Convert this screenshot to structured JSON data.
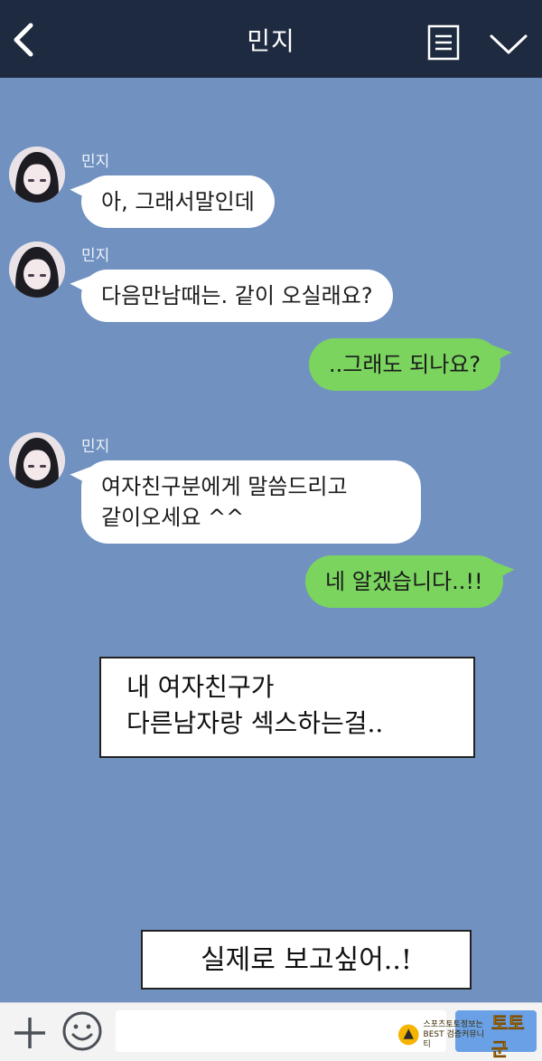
{
  "header": {
    "title": "민지",
    "back_icon": "chevron-left-icon",
    "menu_icon": "document-list-icon",
    "collapse_icon": "chevron-down-icon",
    "background": "#1e2a3f"
  },
  "chat": {
    "background": "#7192c1",
    "messages": [
      {
        "type": "received",
        "sender": "민지",
        "text": "아, 그래서말인데"
      },
      {
        "type": "received",
        "sender": "민지",
        "text": "다음만남때는. 같이 오실래요?"
      },
      {
        "type": "sent",
        "text": "..그래도 되나요?"
      },
      {
        "type": "received",
        "sender": "민지",
        "text": "여자친구분에게 말씀드리고\n같이오세요 ^^"
      },
      {
        "type": "sent",
        "text": "네 알겠습니다..!!"
      }
    ]
  },
  "captions": [
    {
      "text": "내 여자친구가\n다른남자랑 섹스하는걸.."
    },
    {
      "text": "실제로 보고싶어..!"
    }
  ],
  "bottom_bar": {
    "plus_icon": "plus-icon",
    "emoji_icon": "smiley-icon",
    "input_value": "",
    "send_color": "#6aa1e6"
  },
  "watermark": {
    "line1": "스포츠토토정보는",
    "line2": "BEST 검증커뮤니티",
    "brand": "토토군"
  }
}
